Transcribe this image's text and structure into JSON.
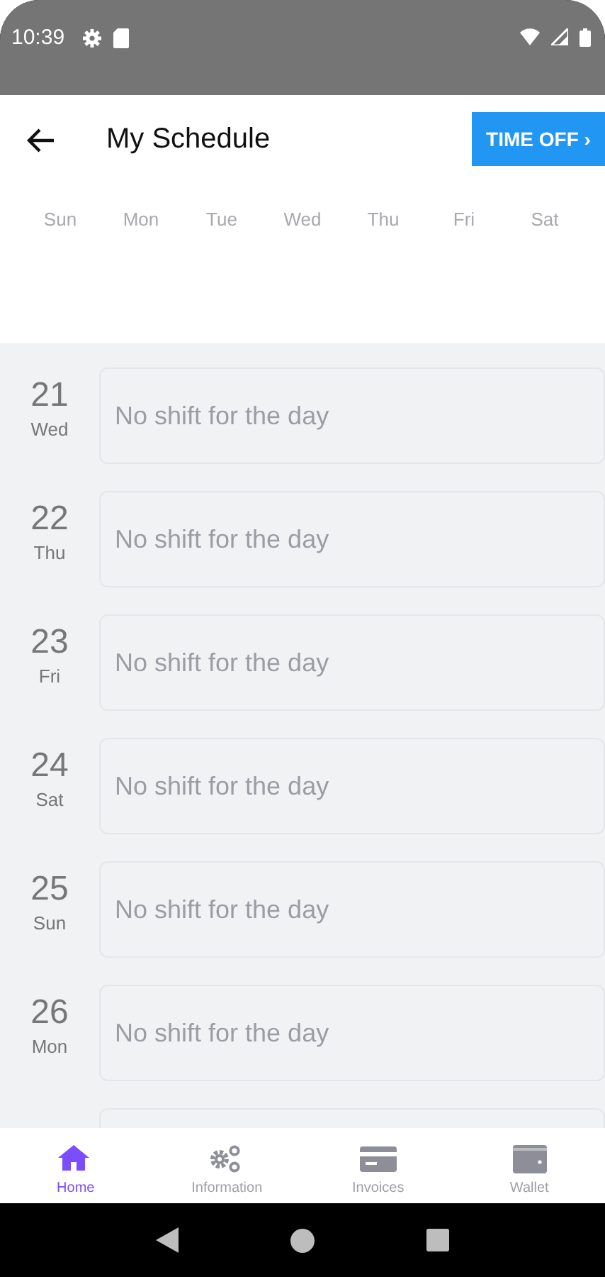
{
  "status_bar": {
    "time": "10:39"
  },
  "header": {
    "title": "My Schedule",
    "action": "TIME OFF ›"
  },
  "weekdays": [
    "Sun",
    "Mon",
    "Tue",
    "Wed",
    "Thu",
    "Fri",
    "Sat"
  ],
  "days": [
    {
      "date": "21",
      "weekday": "Wed",
      "shift": "No shift for the day"
    },
    {
      "date": "22",
      "weekday": "Thu",
      "shift": "No shift for the day"
    },
    {
      "date": "23",
      "weekday": "Fri",
      "shift": "No shift for the day"
    },
    {
      "date": "24",
      "weekday": "Sat",
      "shift": "No shift for the day"
    },
    {
      "date": "25",
      "weekday": "Sun",
      "shift": "No shift for the day"
    },
    {
      "date": "26",
      "weekday": "Mon",
      "shift": "No shift for the day"
    }
  ],
  "bottom_nav": [
    {
      "label": "Home",
      "kind": "home",
      "selected": true
    },
    {
      "label": "Information",
      "kind": "gears",
      "selected": false
    },
    {
      "label": "Invoices",
      "kind": "card",
      "selected": false
    },
    {
      "label": "Wallet",
      "kind": "wallet",
      "selected": false
    }
  ]
}
